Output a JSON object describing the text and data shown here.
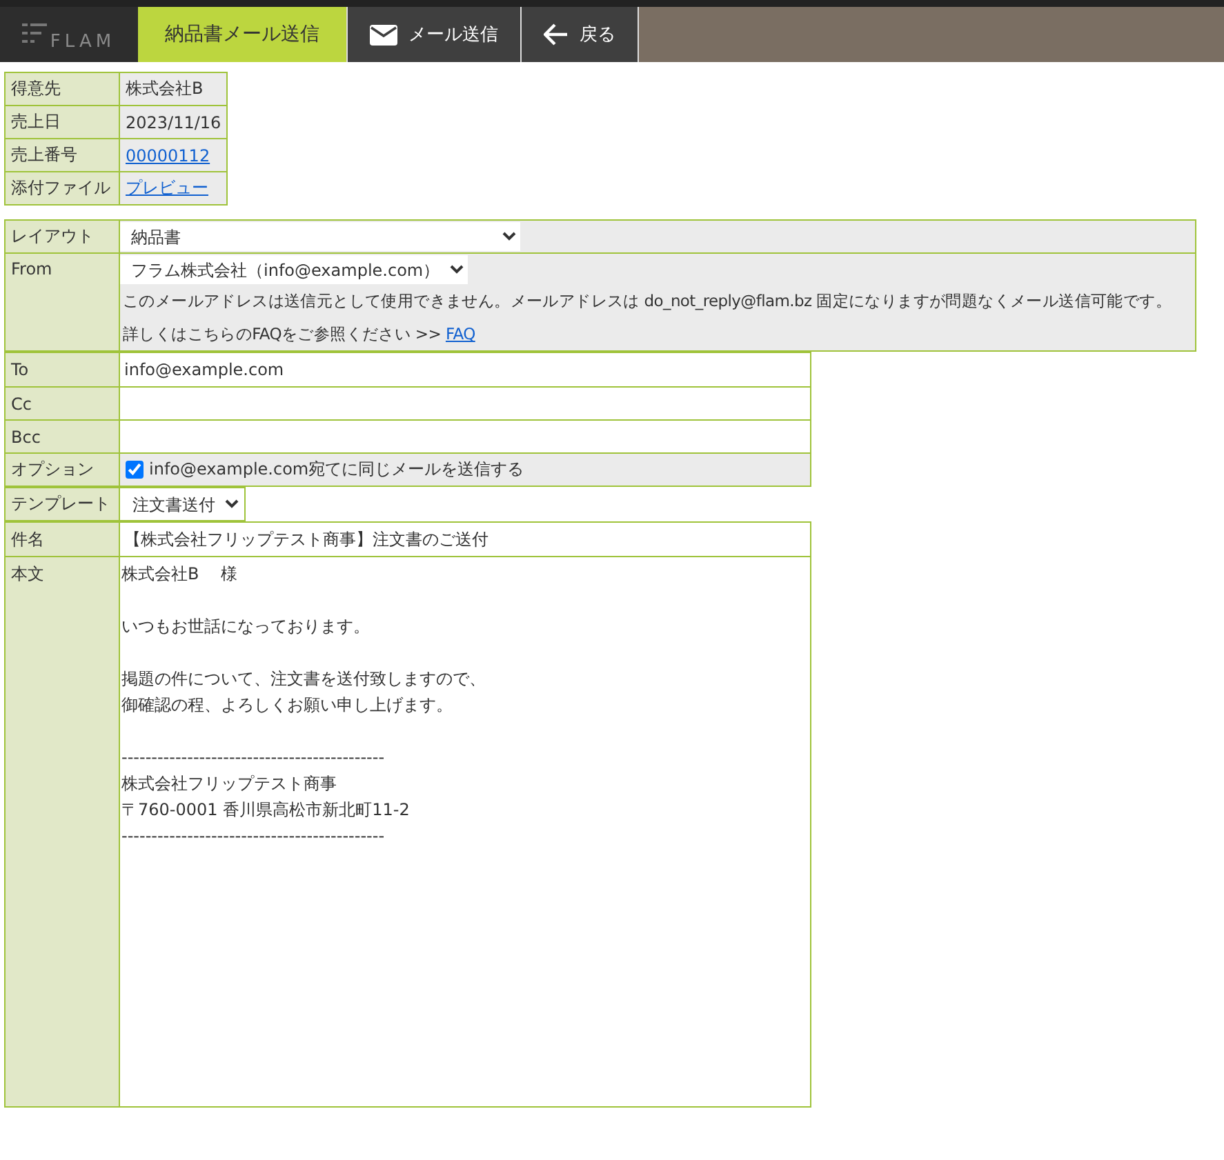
{
  "header": {
    "logo": "FLAM",
    "tabs": [
      {
        "label": "納品書メール送信",
        "kind": "title",
        "selected": true
      },
      {
        "label": "メール送信",
        "kind": "mail",
        "selected": false
      },
      {
        "label": "戻る",
        "kind": "back",
        "selected": false
      }
    ]
  },
  "info": [
    {
      "label": "得意先",
      "value": "株式会社B",
      "kind": "text"
    },
    {
      "label": "売上日",
      "value": "2023/11/16",
      "kind": "text"
    },
    {
      "label": "売上番号",
      "value": "00000112",
      "kind": "link"
    },
    {
      "label": "添付ファイル",
      "value": "プレビュー",
      "kind": "link"
    }
  ],
  "layout": {
    "label": "レイアウト",
    "value": "納品書"
  },
  "from": {
    "label": "From",
    "value": "フラム株式会社（info@example.com）",
    "notice": "このメールアドレスは送信元として使用できません。メールアドレスは do_not_reply@flam.bz 固定になりますが問題なくメール送信可能です。",
    "faq_text": "詳しくはこちらのFAQをご参照ください >>",
    "faq_link": "FAQ"
  },
  "recipients": [
    {
      "label": "To",
      "value": "info@example.com"
    },
    {
      "label": "Cc"
    },
    {
      "label": "Bcc"
    }
  ],
  "option": {
    "label": "オプション",
    "text": "info@example.com宛てに同じメールを送信する",
    "checked": true
  },
  "template": {
    "label": "テンプレート",
    "value": "注文書送付"
  },
  "subject": {
    "label": "件名",
    "value": "【株式会社フリップテスト商事】注文書のご送付"
  },
  "body": {
    "label": "本文",
    "paragraphs": [
      {
        "kind": "text",
        "lines": [
          "株式会社B　 様"
        ]
      },
      {
        "kind": "text",
        "lines": [
          "いつもお世話になっております。"
        ]
      },
      {
        "kind": "text",
        "lines": [
          "掲題の件について、注文書を送付致しますので、",
          "御確認の程、よろしくお願い申し上げます。"
        ]
      },
      {
        "kind": "signature",
        "lines": [
          "--------------------------------------------",
          "株式会社フリップテスト商事",
          "〒760-0001 香川県高松市新北町11-2",
          "--------------------------------------------"
        ]
      }
    ]
  }
}
